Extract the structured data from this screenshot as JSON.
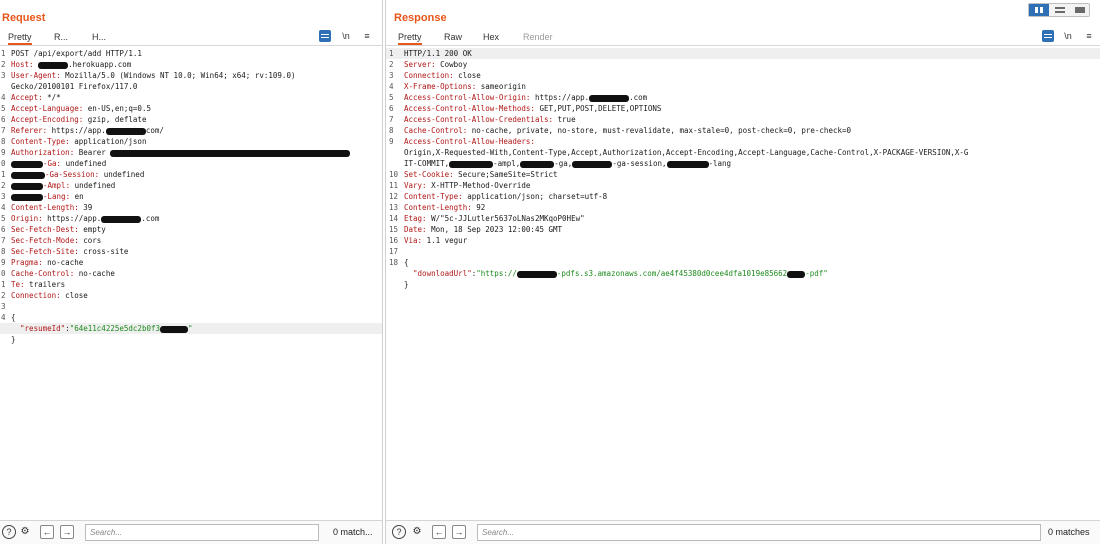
{
  "request": {
    "title": "Request",
    "tabs": [
      {
        "label": "Pretty"
      },
      {
        "label": "R..."
      },
      {
        "label": "H..."
      }
    ],
    "newline_toggle": "\\n",
    "headers": [
      {
        "n": "1",
        "key": "",
        "val": "POST /api/export/add HTTP/1.1"
      },
      {
        "n": "2",
        "key": "Host:",
        "pre": " ",
        "r": 30,
        "val": ".herokuapp.com"
      },
      {
        "n": "3",
        "key": "User-Agent:",
        "val": " Mozilla/5.0 (Windows NT 10.0; Win64; x64; rv:109.0)"
      },
      {
        "n": "",
        "key": "",
        "val": "Gecko/20100101 Firefox/117.0"
      },
      {
        "n": "4",
        "key": "Accept:",
        "val": " */*"
      },
      {
        "n": "5",
        "key": "Accept-Language:",
        "val": " en-US,en;q=0.5"
      },
      {
        "n": "6",
        "key": "Accept-Encoding:",
        "val": " gzip, deflate"
      },
      {
        "n": "7",
        "key": "Referer:",
        "pre": " https://app.",
        "r": 40,
        "val": "com/"
      },
      {
        "n": "8",
        "key": "Content-Type:",
        "val": " application/json"
      },
      {
        "n": "9",
        "key": "Authorization:",
        "pre": " Bearer ",
        "r": 240,
        "val": ""
      },
      {
        "n": "0",
        "key": "",
        "pre": "",
        "r": 32,
        "val": "-Ga: undefined",
        "valkey": true
      },
      {
        "n": "1",
        "key": "",
        "pre": "",
        "r": 34,
        "val": "-Ga-Session: undefined",
        "valkey": true
      },
      {
        "n": "2",
        "key": "",
        "pre": "",
        "r": 32,
        "val": "-Ampl: undefined",
        "valkey": true
      },
      {
        "n": "3",
        "key": "",
        "pre": "",
        "r": 32,
        "val": "-Lang: en",
        "valkey": true
      },
      {
        "n": "4",
        "key": "Content-Length:",
        "val": " 39"
      },
      {
        "n": "5",
        "key": "Origin:",
        "pre": " https://app.",
        "r": 40,
        "val": ".com"
      },
      {
        "n": "6",
        "key": "Sec-Fetch-Dest:",
        "val": " empty"
      },
      {
        "n": "7",
        "key": "Sec-Fetch-Mode:",
        "val": " cors"
      },
      {
        "n": "8",
        "key": "Sec-Fetch-Site:",
        "val": " cross-site"
      },
      {
        "n": "9",
        "key": "Pragma:",
        "val": " no-cache"
      },
      {
        "n": "0",
        "key": "Cache-Control:",
        "val": " no-cache"
      },
      {
        "n": "1",
        "key": "Te:",
        "val": " trailers"
      },
      {
        "n": "2",
        "key": "Connection:",
        "val": " close"
      },
      {
        "n": "3",
        "key": "",
        "val": ""
      },
      {
        "n": "4",
        "key": "",
        "val": "{"
      },
      {
        "n": "",
        "key": "",
        "json_key": "\"resumeId\"",
        "json_val": "\"64e11c4225e5dc2b0f3",
        "r": 28,
        "tail": "\"",
        "hl": true
      },
      {
        "n": "",
        "key": "",
        "val": "}"
      }
    ],
    "search_placeholder": "Search...",
    "matches": "0 match..."
  },
  "response": {
    "title": "Response",
    "tabs": [
      {
        "label": "Pretty"
      },
      {
        "label": "Raw"
      },
      {
        "label": "Hex"
      },
      {
        "label": "Render"
      }
    ],
    "newline_toggle": "\\n",
    "headers": [
      {
        "n": "1",
        "key": "",
        "val": "HTTP/1.1 200 OK",
        "hl": true
      },
      {
        "n": "2",
        "key": "Server:",
        "val": " Cowboy"
      },
      {
        "n": "3",
        "key": "Connection:",
        "val": " close"
      },
      {
        "n": "4",
        "key": "X-Frame-Options:",
        "val": " sameorigin"
      },
      {
        "n": "5",
        "key": "Access-Control-Allow-Origin:",
        "pre": " https://app.",
        "r": 40,
        "val": ".com"
      },
      {
        "n": "6",
        "key": "Access-Control-Allow-Methods:",
        "val": " GET,PUT,POST,DELETE,OPTIONS"
      },
      {
        "n": "7",
        "key": "Access-Control-Allow-Credentials:",
        "val": " true"
      },
      {
        "n": "8",
        "key": "Cache-Control:",
        "val": " no-cache, private, no-store, must-revalidate, max-stale=0, post-check=0, pre-check=0"
      },
      {
        "n": "9",
        "key": "Access-Control-Allow-Headers:",
        "val": ""
      },
      {
        "n": "",
        "key": "",
        "val": "Origin,X-Requested-With,Content-Type,Accept,Authorization,Accept-Encoding,Accept-Language,Cache-Control,X-PACKAGE-VERSION,X-G"
      },
      {
        "n": "",
        "key": "",
        "pre": "IT-COMMIT,",
        "r": 44,
        "val": "-ampl,",
        "r2": 34,
        "val2": "-ga,",
        "r3": 40,
        "val3": "-ga-session,",
        "r4": 42,
        "val4": "-lang"
      },
      {
        "n": "10",
        "key": "Set-Cookie:",
        "val": " Secure;SameSite=Strict"
      },
      {
        "n": "11",
        "key": "Vary:",
        "val": " X-HTTP-Method-Override"
      },
      {
        "n": "12",
        "key": "Content-Type:",
        "val": " application/json; charset=utf-8"
      },
      {
        "n": "13",
        "key": "Content-Length:",
        "val": " 92"
      },
      {
        "n": "14",
        "key": "Etag:",
        "val": " W/\"5c-JJLutler5637oLNas2MKqoP0HEw\""
      },
      {
        "n": "15",
        "key": "Date:",
        "val": " Mon, 18 Sep 2023 12:00:45 GMT"
      },
      {
        "n": "16",
        "key": "Via:",
        "val": " 1.1 vegur"
      },
      {
        "n": "17",
        "key": "",
        "val": ""
      },
      {
        "n": "18",
        "key": "",
        "val": "{"
      },
      {
        "n": "",
        "key": "",
        "json_key": "\"downloadUrl\"",
        "json_val": "\"https://",
        "r": 40,
        "json_val2": "-pdfs.s3.amazonaws.com/ae4f45380d0cee4dfa1019e85662",
        "r2": 18,
        "tail": "-pdf\""
      },
      {
        "n": "",
        "key": "",
        "val": "}"
      }
    ],
    "search_placeholder": "Search...",
    "matches": "0 matches"
  }
}
